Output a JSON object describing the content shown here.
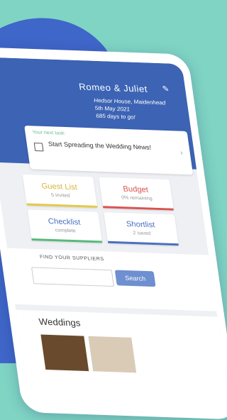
{
  "couple": "Romeo & Juliet",
  "venue": "Hedsor House, Maidenhead",
  "date": "5th May 2021",
  "countdown": "685 days to go!",
  "task": {
    "label": "Your next task:",
    "text": "Start Spreading the Wedding News!"
  },
  "tiles": [
    {
      "title": "Guest List",
      "sub": "5 invited",
      "color": "#e4c94a",
      "icon": "person-icon"
    },
    {
      "title": "Budget",
      "sub": "0% remaining",
      "color": "#d9534f",
      "icon": "coins-icon"
    },
    {
      "title": "Checklist",
      "sub": "complete",
      "color": "#56b97a",
      "icon": "checklist-icon"
    },
    {
      "title": "Shortlist",
      "sub": "2 saved",
      "color": "#4a6fc0",
      "icon": "heart-icon"
    }
  ],
  "suppliers": {
    "label": "FIND YOUR SUPPLIERS",
    "button": "Search"
  },
  "weddings": {
    "title": "Weddings"
  }
}
